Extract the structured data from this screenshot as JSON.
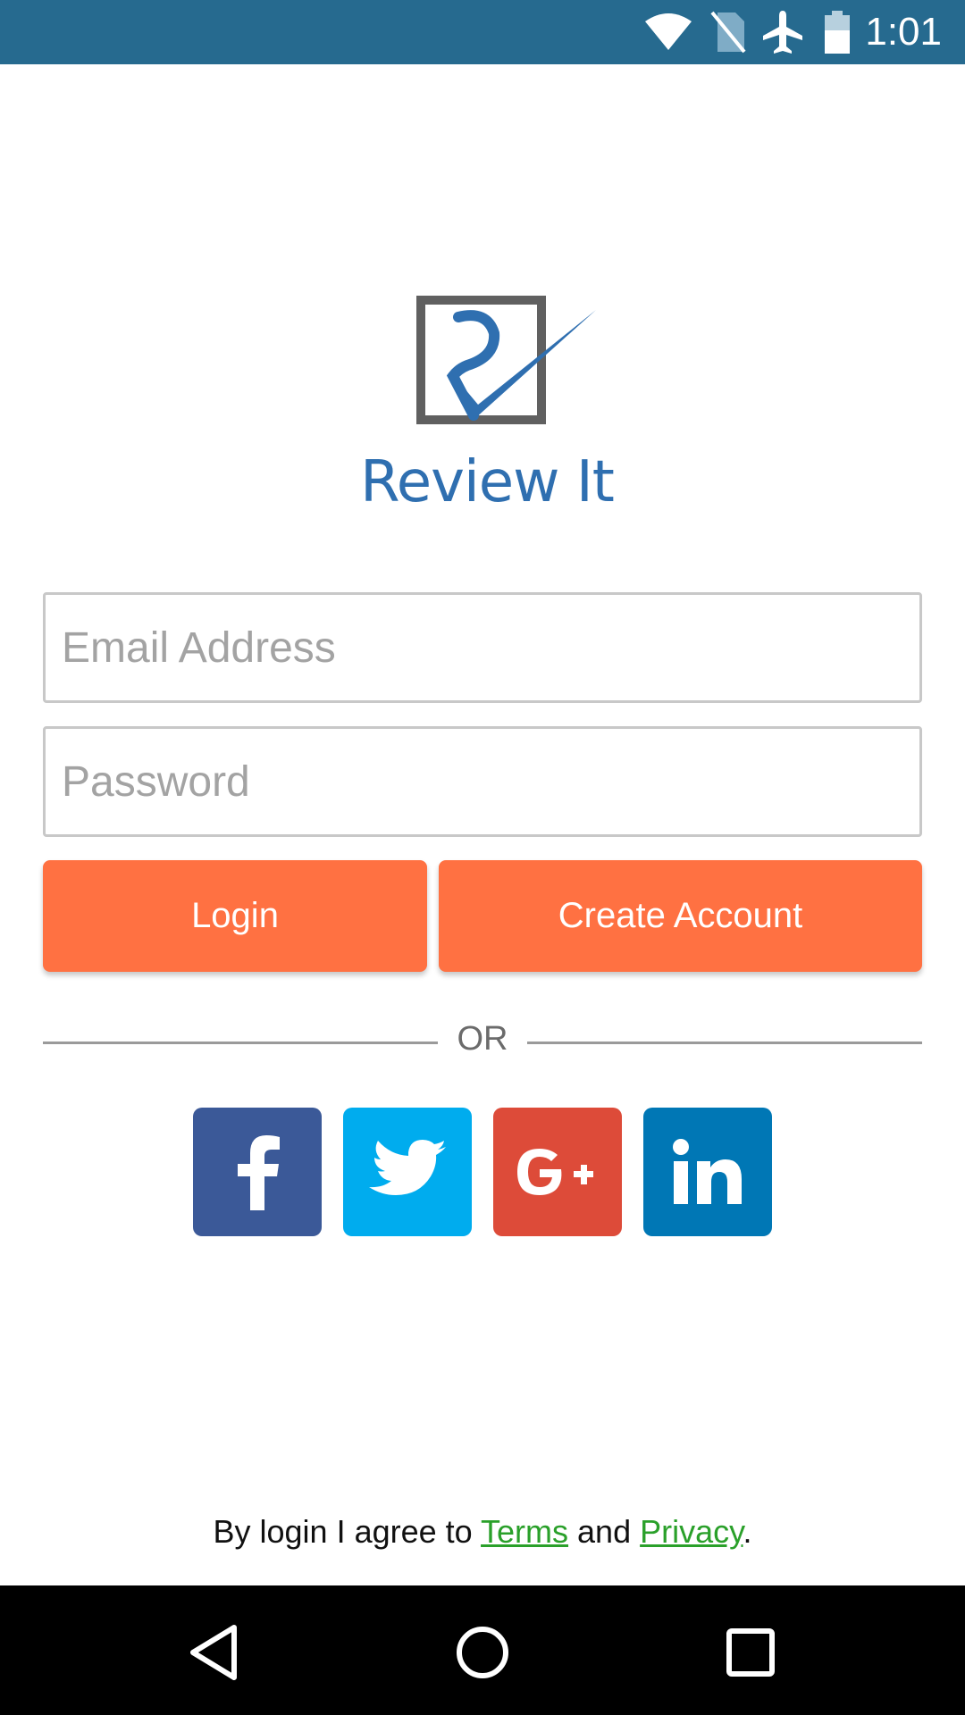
{
  "status_bar": {
    "time": "1:01",
    "icons": [
      "wifi-icon",
      "no-sim-icon",
      "airplane-mode-icon",
      "battery-icon"
    ],
    "background": "#266a8f"
  },
  "logo": {
    "text": "Review It",
    "icon": "review-it-logo-icon",
    "colors": {
      "frame": "#606060",
      "check": "#2f6fb0"
    }
  },
  "form": {
    "email_placeholder": "Email Address",
    "email_value": "",
    "password_placeholder": "Password",
    "password_value": ""
  },
  "buttons": {
    "login": "Login",
    "create_account": "Create Account",
    "color": "#ff7142"
  },
  "divider": {
    "text": "OR"
  },
  "social": [
    {
      "name": "facebook",
      "icon": "facebook-icon",
      "color": "#3b5998"
    },
    {
      "name": "twitter",
      "icon": "twitter-icon",
      "color": "#00acee"
    },
    {
      "name": "google-plus",
      "icon": "google-plus-icon",
      "color": "#dd4b39"
    },
    {
      "name": "linkedin",
      "icon": "linkedin-icon",
      "color": "#0077b5"
    }
  ],
  "footer": {
    "prefix": "By login I agree to ",
    "terms_label": "Terms",
    "middle": " and ",
    "privacy_label": "Privacy",
    "suffix": ".",
    "link_color": "#2aa02a"
  },
  "nav_bar": {
    "icons": [
      "back-icon",
      "home-icon",
      "recent-apps-icon"
    ]
  }
}
